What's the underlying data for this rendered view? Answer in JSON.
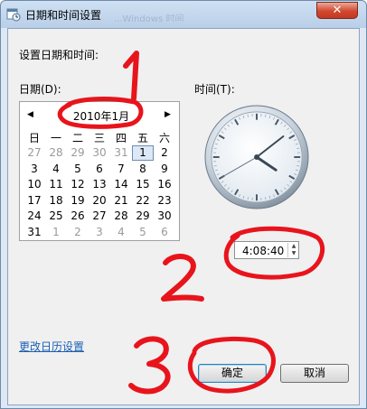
{
  "window": {
    "title": "日期和时间设置",
    "ghost_title": "...Windows 时间",
    "close_glyph": "✕"
  },
  "main": {
    "heading": "设置日期和时间:",
    "date_label": "日期(D):",
    "time_label": "时间(T):",
    "calendar": {
      "prev_glyph": "◀",
      "next_glyph": "▶",
      "month_title": "2010年1月",
      "weekdays": [
        "日",
        "一",
        "二",
        "三",
        "四",
        "五",
        "六"
      ],
      "weeks": [
        [
          "27",
          "28",
          "29",
          "30",
          "31",
          "1",
          "2"
        ],
        [
          "3",
          "4",
          "5",
          "6",
          "7",
          "8",
          "9"
        ],
        [
          "10",
          "11",
          "12",
          "13",
          "14",
          "15",
          "16"
        ],
        [
          "17",
          "18",
          "19",
          "20",
          "21",
          "22",
          "23"
        ],
        [
          "24",
          "25",
          "26",
          "27",
          "28",
          "29",
          "30"
        ],
        [
          "31",
          "1",
          "2",
          "3",
          "4",
          "5",
          "6"
        ]
      ],
      "selected_day": "1"
    },
    "clock": {
      "hour": 4,
      "minute": 8,
      "second": 40
    },
    "time_value": "4:08:40",
    "spin_up": "▲",
    "spin_down": "▼",
    "change_calendar_link": "更改日历设置",
    "ok_button": "确定",
    "cancel_button": "取消"
  },
  "colors": {
    "annotation_red": "#e8141c",
    "link": "#1a5fb4"
  }
}
